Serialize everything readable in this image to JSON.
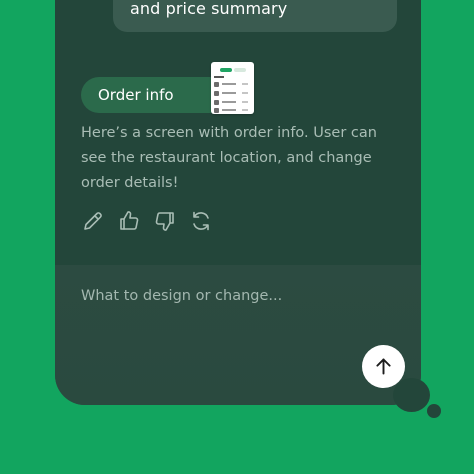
{
  "conversation": {
    "previous_message_tail": "and price summary",
    "attachment": {
      "label": "Order info"
    },
    "response_text": "Here’s a screen with order info. User can see the restaurant location, and change order details!",
    "actions": [
      {
        "name": "edit",
        "icon": "pencil-icon"
      },
      {
        "name": "like",
        "icon": "thumbs-up-icon"
      },
      {
        "name": "dislike",
        "icon": "thumbs-down-icon"
      },
      {
        "name": "regenerate",
        "icon": "refresh-icon"
      }
    ]
  },
  "composer": {
    "placeholder": "What to design or change...",
    "send_icon": "arrow-up-icon"
  },
  "colors": {
    "background": "#12a55f",
    "card": "#23463a",
    "chip": "#2b6a4b",
    "text_muted": "#a9bdb5",
    "send_button": "#ffffff"
  }
}
